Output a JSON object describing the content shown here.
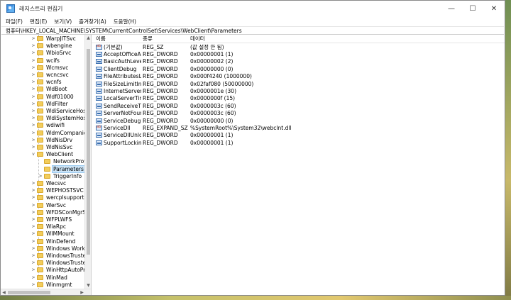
{
  "window": {
    "title": "레지스트리 편집기"
  },
  "controls": {
    "minimize": "—",
    "maximize": "☐",
    "close": "✕"
  },
  "menu": [
    "파일(F)",
    "편집(E)",
    "보기(V)",
    "즐겨찾기(A)",
    "도움말(H)"
  ],
  "address": "컴퓨터\\HKEY_LOCAL_MACHINE\\SYSTEM\\CurrentControlSet\\Services\\WebClient\\Parameters",
  "tree": {
    "items": [
      {
        "label": "WarpJITSvc",
        "expander": ">",
        "depth": 0
      },
      {
        "label": "wbengine",
        "expander": ">",
        "depth": 0
      },
      {
        "label": "WbioSrvc",
        "expander": ">",
        "depth": 0
      },
      {
        "label": "wcifs",
        "expander": ">",
        "depth": 0
      },
      {
        "label": "Wcmsvc",
        "expander": ">",
        "depth": 0
      },
      {
        "label": "wcncsvc",
        "expander": ">",
        "depth": 0
      },
      {
        "label": "wcnfs",
        "expander": ">",
        "depth": 0
      },
      {
        "label": "WdBoot",
        "expander": ">",
        "depth": 0
      },
      {
        "label": "Wdf01000",
        "expander": ">",
        "depth": 0
      },
      {
        "label": "WdFilter",
        "expander": ">",
        "depth": 0
      },
      {
        "label": "WdiServiceHost",
        "expander": ">",
        "depth": 0
      },
      {
        "label": "WdiSystemHost",
        "expander": ">",
        "depth": 0
      },
      {
        "label": "wdiwifi",
        "expander": ">",
        "depth": 0
      },
      {
        "label": "WdmCompanionF",
        "expander": ">",
        "depth": 0
      },
      {
        "label": "WdNisDrv",
        "expander": ">",
        "depth": 0
      },
      {
        "label": "WdNisSvc",
        "expander": ">",
        "depth": 0
      },
      {
        "label": "WebClient",
        "expander": "v",
        "depth": 0
      },
      {
        "label": "NetworkProvid",
        "expander": "",
        "depth": 1
      },
      {
        "label": "Parameters",
        "expander": "",
        "depth": 1,
        "selected": true
      },
      {
        "label": "TriggerInfo",
        "expander": ">",
        "depth": 1
      },
      {
        "label": "Wecsvc",
        "expander": ">",
        "depth": 0
      },
      {
        "label": "WEPHOSTSVC",
        "expander": ">",
        "depth": 0
      },
      {
        "label": "wercplsupport",
        "expander": ">",
        "depth": 0
      },
      {
        "label": "WerSvc",
        "expander": ">",
        "depth": 0
      },
      {
        "label": "WFDSConMgrSvc",
        "expander": ">",
        "depth": 0
      },
      {
        "label": "WFPLWFS",
        "expander": ">",
        "depth": 0
      },
      {
        "label": "WiaRpc",
        "expander": ">",
        "depth": 0
      },
      {
        "label": "WIMMount",
        "expander": ">",
        "depth": 0
      },
      {
        "label": "WinDefend",
        "expander": ">",
        "depth": 0
      },
      {
        "label": "Windows Workflo",
        "expander": ">",
        "depth": 0
      },
      {
        "label": "WindowsTrustedR",
        "expander": ">",
        "depth": 0
      },
      {
        "label": "WindowsTrustedR",
        "expander": ">",
        "depth": 0
      },
      {
        "label": "WinHttpAutoProx",
        "expander": ">",
        "depth": 0
      },
      {
        "label": "WinMad",
        "expander": ">",
        "depth": 0
      },
      {
        "label": "Winmgmt",
        "expander": ">",
        "depth": 0
      }
    ]
  },
  "columns": {
    "name": "이름",
    "type": "종류",
    "data": "데이터"
  },
  "values": [
    {
      "icon": "sz",
      "name": "(기본값)",
      "type": "REG_SZ",
      "data": "(값 설정 안 됨)"
    },
    {
      "icon": "dw",
      "name": "AcceptOfficeAn...",
      "type": "REG_DWORD",
      "data": "0x00000001 (1)"
    },
    {
      "icon": "dw",
      "name": "BasicAuthLevel",
      "type": "REG_DWORD",
      "data": "0x00000002 (2)"
    },
    {
      "icon": "dw",
      "name": "ClientDebug",
      "type": "REG_DWORD",
      "data": "0x00000000 (0)"
    },
    {
      "icon": "dw",
      "name": "FileAttributesLi...",
      "type": "REG_DWORD",
      "data": "0x000f4240 (1000000)"
    },
    {
      "icon": "dw",
      "name": "FileSizeLimitInB...",
      "type": "REG_DWORD",
      "data": "0x02faf080 (50000000)"
    },
    {
      "icon": "dw",
      "name": "InternetServerTi...",
      "type": "REG_DWORD",
      "data": "0x0000001e (30)"
    },
    {
      "icon": "dw",
      "name": "LocalServerTime...",
      "type": "REG_DWORD",
      "data": "0x0000000f (15)"
    },
    {
      "icon": "dw",
      "name": "SendReceiveTim...",
      "type": "REG_DWORD",
      "data": "0x0000003c (60)"
    },
    {
      "icon": "dw",
      "name": "ServerNotFound...",
      "type": "REG_DWORD",
      "data": "0x0000003c (60)"
    },
    {
      "icon": "dw",
      "name": "ServiceDebug",
      "type": "REG_DWORD",
      "data": "0x00000000 (0)"
    },
    {
      "icon": "sz",
      "name": "ServiceDll",
      "type": "REG_EXPAND_SZ",
      "data": "%SystemRoot%\\System32\\webclnt.dll"
    },
    {
      "icon": "dw",
      "name": "ServiceDllUnloa...",
      "type": "REG_DWORD",
      "data": "0x00000001 (1)"
    },
    {
      "icon": "dw",
      "name": "SupportLocking",
      "type": "REG_DWORD",
      "data": "0x00000001 (1)"
    }
  ]
}
